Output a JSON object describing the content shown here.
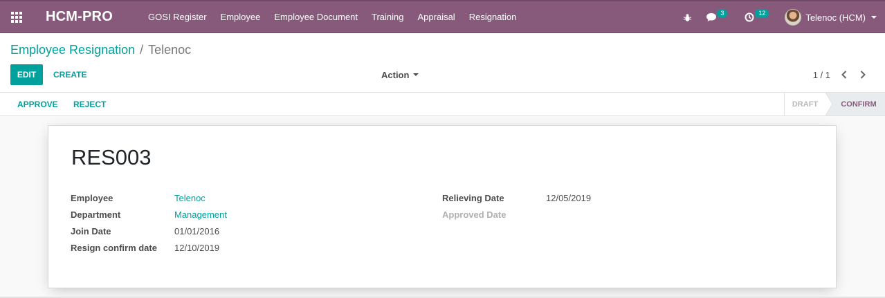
{
  "navbar": {
    "brand": "HCM-PRO",
    "menu": [
      {
        "label": "GOSI Register"
      },
      {
        "label": "Employee"
      },
      {
        "label": "Employee Document"
      },
      {
        "label": "Training"
      },
      {
        "label": "Appraisal"
      },
      {
        "label": "Resignation"
      }
    ],
    "messages_count": "3",
    "activities_count": "12",
    "user_name": "Telenoc (HCM)"
  },
  "breadcrumb": {
    "parent": "Employee Resignation",
    "separator": "/",
    "current": "Telenoc"
  },
  "toolbar": {
    "edit_label": "EDIT",
    "create_label": "CREATE",
    "action_label": "Action",
    "pager": "1 / 1"
  },
  "statusbar": {
    "approve_label": "APPROVE",
    "reject_label": "REJECT",
    "stages": [
      "DRAFT",
      "CONFIRM"
    ],
    "active_stage": "CONFIRM"
  },
  "record": {
    "name": "RES003",
    "left_fields": [
      {
        "label": "Employee",
        "value": "Telenoc",
        "is_link": true
      },
      {
        "label": "Department",
        "value": "Management",
        "is_link": true
      },
      {
        "label": "Join Date",
        "value": "01/01/2016",
        "is_link": false
      },
      {
        "label": "Resign confirm date",
        "value": "12/10/2019",
        "is_link": false
      }
    ],
    "right_fields": [
      {
        "label": "Relieving Date",
        "value": "12/05/2019"
      },
      {
        "label": "Approved Date",
        "value": ""
      }
    ]
  },
  "colors": {
    "brand": "#875a7b",
    "accent": "#00a09d"
  }
}
